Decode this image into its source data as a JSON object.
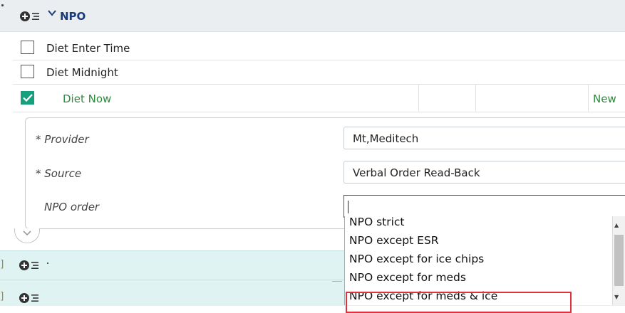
{
  "section": {
    "title": "NPO",
    "add_icon": "add-list-icon",
    "toggle_icon": "chevron-down-icon"
  },
  "rows": [
    {
      "label": "Diet Enter Time",
      "checked": false
    },
    {
      "label": "Diet Midnight",
      "checked": false
    },
    {
      "label": "Diet Now",
      "checked": true,
      "status": "New"
    }
  ],
  "detail": {
    "provider_label": "* Provider",
    "provider_value": "Mt,Meditech",
    "source_label": "* Source",
    "source_value": "Verbal Order Read-Back",
    "npo_label": "NPO order",
    "npo_value": ""
  },
  "dropdown": {
    "options": [
      "NPO strict",
      "NPO except ESR",
      "NPO except for ice chips",
      "NPO except for meds",
      "NPO except for meds & ice"
    ],
    "highlighted": "NPO except for meds & ice"
  },
  "colors": {
    "header_bg": "#eaeef1",
    "title": "#1a3a7a",
    "checked": "#17a07e",
    "active_text": "#2c8a3c",
    "teal_row": "#dff3f3",
    "highlight": "#e0313d"
  }
}
